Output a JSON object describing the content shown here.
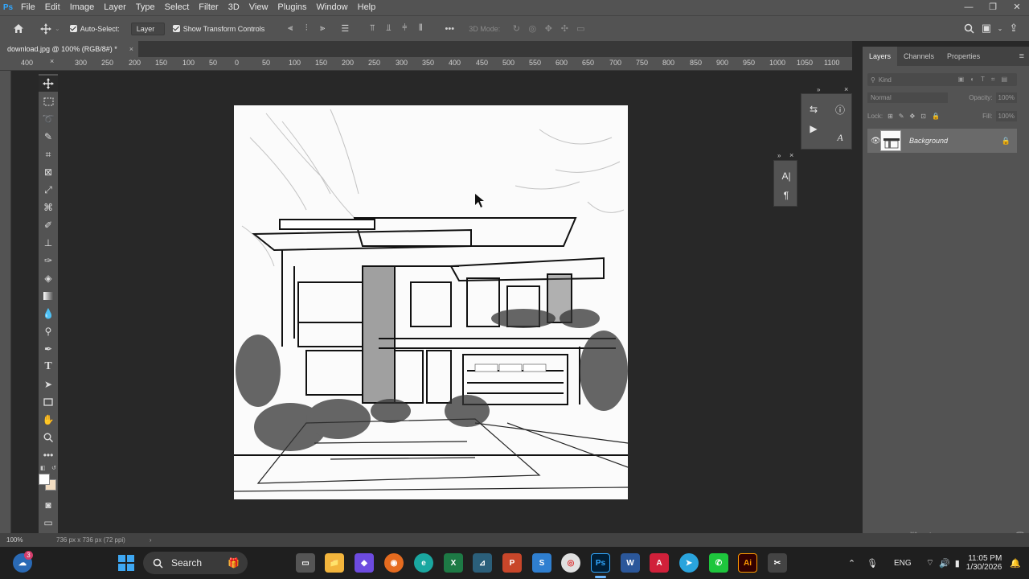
{
  "app": {
    "logo": "Ps",
    "accent": "#31a8ff"
  },
  "menu": [
    "File",
    "Edit",
    "Image",
    "Layer",
    "Type",
    "Select",
    "Filter",
    "3D",
    "View",
    "Plugins",
    "Window",
    "Help"
  ],
  "window_controls": {
    "minimize": "—",
    "maximize": "❐",
    "close": "✕"
  },
  "options": {
    "auto_select_label": "Auto-Select:",
    "auto_select_target": "Layer",
    "show_transform_label": "Show Transform Controls",
    "three_d_mode_label": "3D Mode:"
  },
  "document_tab": {
    "title": "download.jpg @ 100% (RGB/8#) *",
    "close": "×"
  },
  "ruler_labels": [
    "400",
    "300",
    "250",
    "200",
    "150",
    "100",
    "50",
    "0",
    "50",
    "100",
    "150",
    "200",
    "250",
    "300",
    "350",
    "400",
    "450",
    "500",
    "550",
    "600",
    "650",
    "700",
    "750",
    "800",
    "850",
    "900",
    "950",
    "1000",
    "1050",
    "1100"
  ],
  "tools": [
    "move-tool",
    "marquee-tool",
    "lasso-tool",
    "quick-select-tool",
    "crop-tool",
    "frame-tool",
    "eyedropper-tool",
    "healing-tool",
    "brush-tool",
    "stamp-tool",
    "history-brush-tool",
    "eraser-tool",
    "gradient-tool",
    "blur-tool",
    "dodge-tool",
    "pen-tool",
    "type-tool",
    "path-select-tool",
    "rectangle-tool",
    "hand-tool",
    "zoom-tool",
    "more-tools"
  ],
  "layers_panel": {
    "tabs": [
      "Layers",
      "Channels",
      "Properties"
    ],
    "filter_kind": "Kind",
    "blend_mode": "Normal",
    "opacity_label": "Opacity:",
    "opacity_value": "100%",
    "lock_label": "Lock:",
    "fill_label": "Fill:",
    "fill_value": "100%",
    "layer_name": "Background"
  },
  "status": {
    "zoom": "100%",
    "doc_info": "736 px x 736 px (72 ppi)",
    "arrow": "›"
  },
  "taskbar": {
    "search_label": "Search",
    "language": "ENG",
    "time": "11:05 PM",
    "date": "1/30/2026",
    "notification_count": "3"
  },
  "colors": {
    "menubar": "#535353",
    "canvas_bg": "#282828",
    "taskbar": "#1f1f1f"
  }
}
